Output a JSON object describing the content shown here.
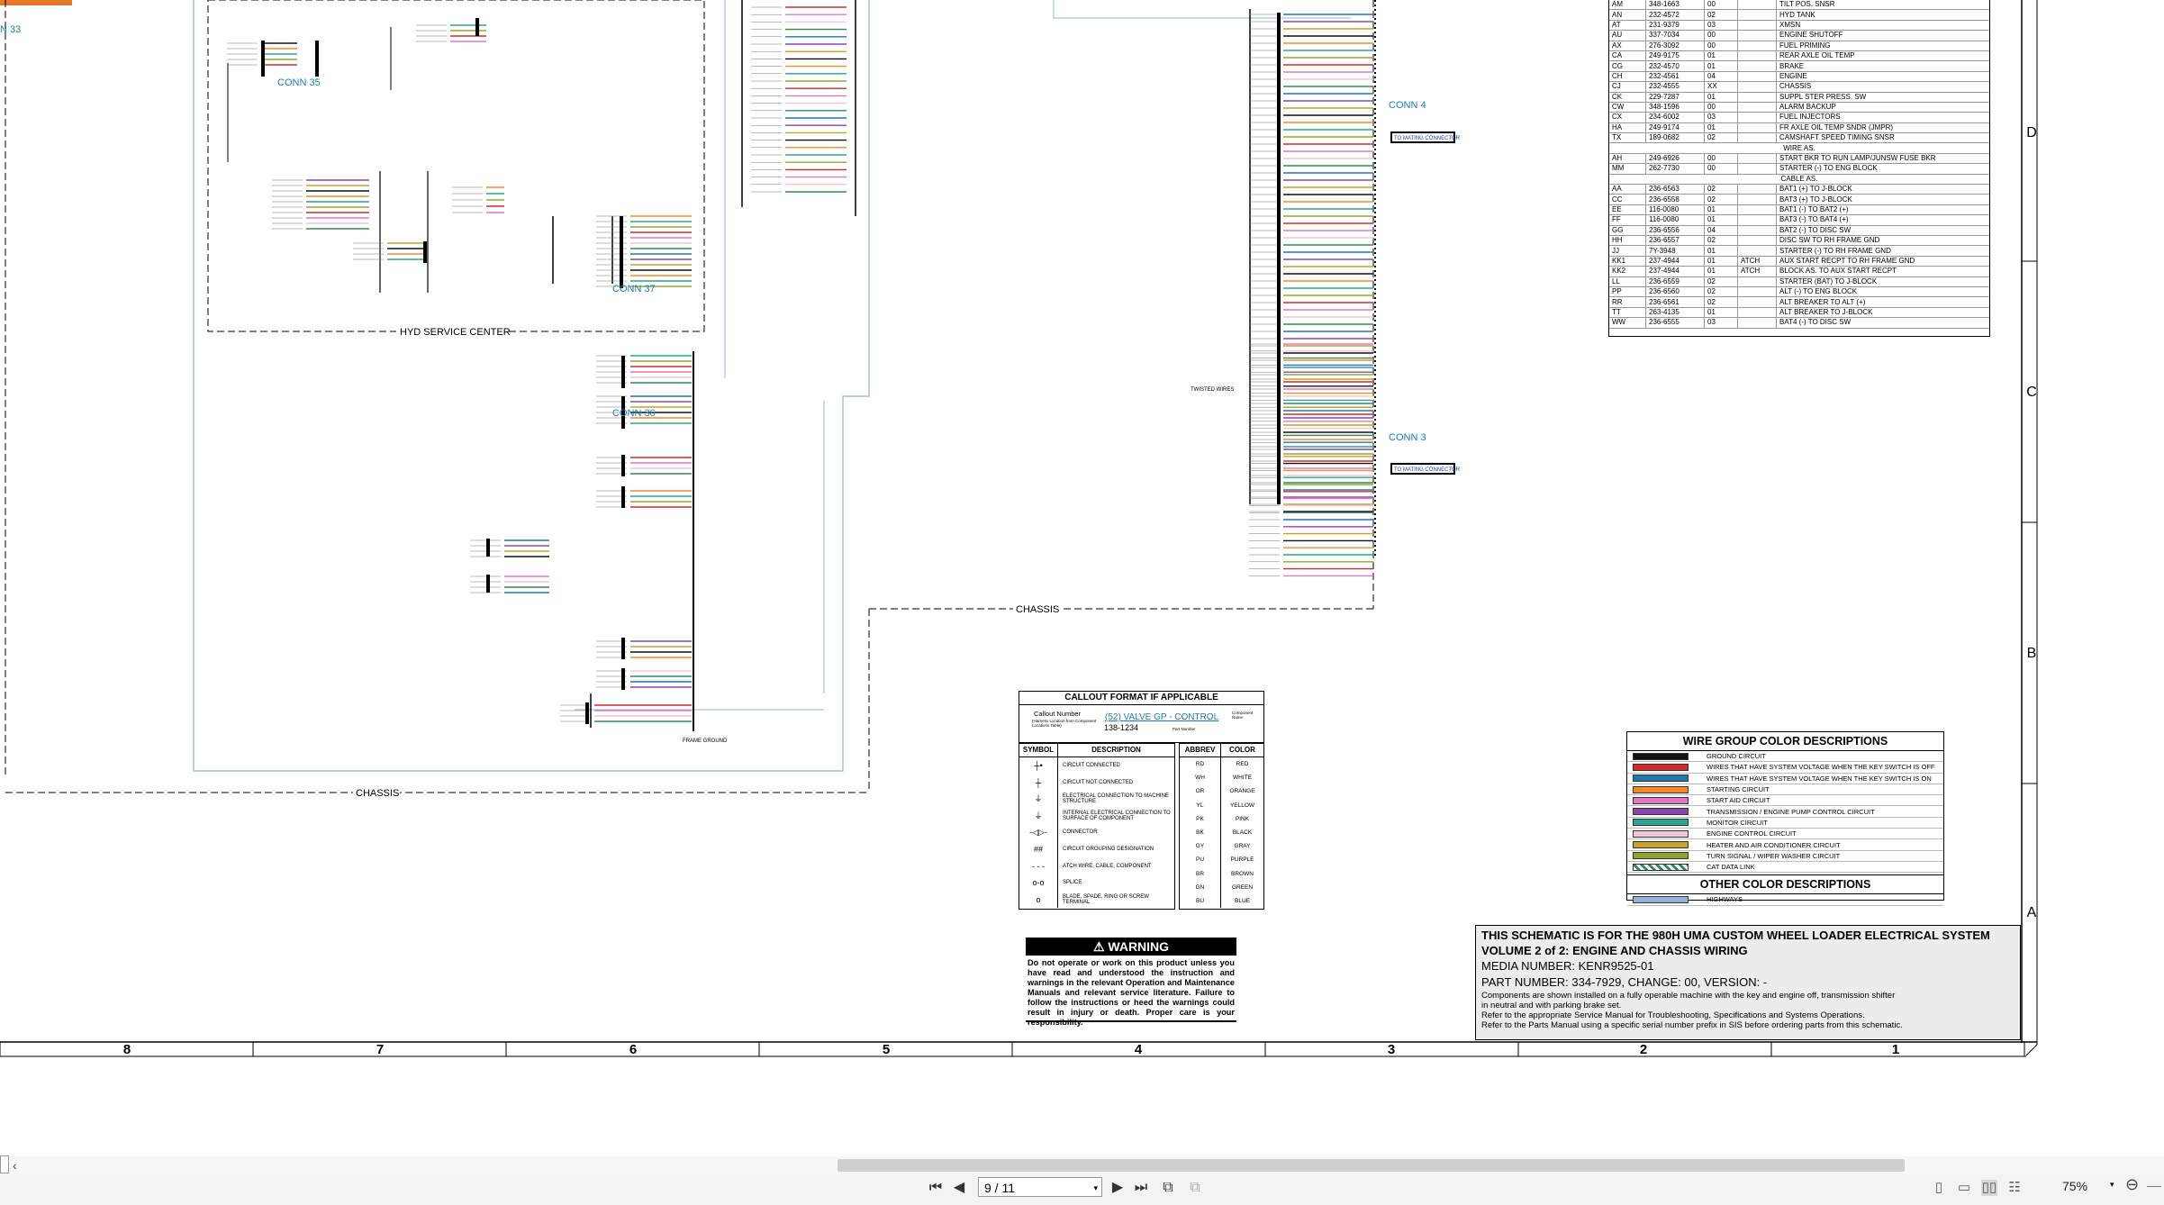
{
  "schematic": {
    "connectors": {
      "conn33": "N 33",
      "conn35": "CONN 35",
      "conn36": "CONN 36",
      "conn37": "CONN 37",
      "conn4": "CONN 4",
      "conn3": "CONN 3"
    },
    "labels": {
      "hyd_service_center": "HYD SERVICE CENTER",
      "chassis_left": "CHASSIS",
      "chassis_right": "CHASSIS",
      "frame_ground": "FRAME GROUND",
      "twisted_wires": "TWISTED WIRES",
      "to_mating_connector_1": "TO MATING CONNECTOR",
      "to_mating_connector_2": "TO MATING CONNECTOR"
    },
    "row_labels": [
      "D",
      "C",
      "B",
      "A"
    ],
    "column_labels": [
      "8",
      "7",
      "6",
      "5",
      "4",
      "3",
      "2",
      "1"
    ]
  },
  "cable_table": {
    "rows": [
      {
        "code": "AM",
        "part": "348-1663",
        "rev": "00",
        "atch": "",
        "desc": "TILT POS. SNSR"
      },
      {
        "code": "AN",
        "part": "232-4572",
        "rev": "02",
        "atch": "",
        "desc": "HYD TANK"
      },
      {
        "code": "AT",
        "part": "231-9379",
        "rev": "03",
        "atch": "",
        "desc": "XMSN"
      },
      {
        "code": "AU",
        "part": "337-7034",
        "rev": "00",
        "atch": "",
        "desc": "ENGINE SHUTOFF"
      },
      {
        "code": "AX",
        "part": "276-3092",
        "rev": "00",
        "atch": "",
        "desc": "FUEL PRIMING"
      },
      {
        "code": "CA",
        "part": "249-9175",
        "rev": "01",
        "atch": "",
        "desc": "REAR AXLE OIL TEMP"
      },
      {
        "code": "CG",
        "part": "232-4570",
        "rev": "01",
        "atch": "",
        "desc": "BRAKE"
      },
      {
        "code": "CH",
        "part": "232-4561",
        "rev": "04",
        "atch": "",
        "desc": "ENGINE"
      },
      {
        "code": "CJ",
        "part": "232-4555",
        "rev": "XX",
        "atch": "",
        "desc": "CHASSIS"
      },
      {
        "code": "CK",
        "part": "229-7287",
        "rev": "01",
        "atch": "",
        "desc": "SUPPL STER PRESS. SW"
      },
      {
        "code": "CW",
        "part": "348-1596",
        "rev": "00",
        "atch": "",
        "desc": "ALARM BACKUP"
      },
      {
        "code": "CX",
        "part": "234-6002",
        "rev": "03",
        "atch": "",
        "desc": "FUEL INJECTORS"
      },
      {
        "code": "HA",
        "part": "249-9174",
        "rev": "01",
        "atch": "",
        "desc": "FR AXLE OIL TEMP SNDR (JMPR)"
      },
      {
        "code": "TX",
        "part": "189-0682",
        "rev": "02",
        "atch": "",
        "desc": "CAMSHAFT SPEED TIMING SNSR"
      }
    ],
    "wire_as_header": "WIRE AS.",
    "wire_as_rows": [
      {
        "code": "AH",
        "part": "249-6926",
        "rev": "00",
        "atch": "",
        "desc": "START BKR TO RUN LAMP/JUNSW FUSE BKR"
      },
      {
        "code": "MM",
        "part": "262-7730",
        "rev": "00",
        "atch": "",
        "desc": "STARTER (-) TO ENG BLOCK"
      }
    ],
    "cable_as_header": "CABLE AS.",
    "cable_as_rows": [
      {
        "code": "AA",
        "part": "236-6563",
        "rev": "02",
        "atch": "",
        "desc": "BAT1 (+) TO J-BLOCK"
      },
      {
        "code": "CC",
        "part": "236-6558",
        "rev": "02",
        "atch": "",
        "desc": "BAT3 (+) TO J-BLOCK"
      },
      {
        "code": "EE",
        "part": "116-0080",
        "rev": "01",
        "atch": "",
        "desc": "BAT1 (-) TO BAT2 (+)"
      },
      {
        "code": "FF",
        "part": "116-0080",
        "rev": "01",
        "atch": "",
        "desc": "BAT3 (-) TO BAT4 (+)"
      },
      {
        "code": "GG",
        "part": "236-6556",
        "rev": "04",
        "atch": "",
        "desc": "BAT2 (-) TO DISC SW"
      },
      {
        "code": "HH",
        "part": "236-6557",
        "rev": "02",
        "atch": "",
        "desc": "DISC SW TO RH FRAME GND"
      },
      {
        "code": "JJ",
        "part": "7Y-3948",
        "rev": "01",
        "atch": "",
        "desc": "STARTER (-) TO RH FRAME GND"
      },
      {
        "code": "KK1",
        "part": "237-4944",
        "rev": "01",
        "atch": "ATCH",
        "desc": "AUX START RECPT TO RH FRAME GND"
      },
      {
        "code": "KK2",
        "part": "237-4944",
        "rev": "01",
        "atch": "ATCH",
        "desc": "BLOCK AS. TO AUX START RECPT"
      },
      {
        "code": "LL",
        "part": "236-6559",
        "rev": "02",
        "atch": "",
        "desc": "STARTER (BAT) TO J-BLOCK"
      },
      {
        "code": "PP",
        "part": "236-6560",
        "rev": "02",
        "atch": "",
        "desc": "ALT (-) TO ENG BLOCK"
      },
      {
        "code": "RR",
        "part": "236-6561",
        "rev": "02",
        "atch": "",
        "desc": "ALT BREAKER TO ALT (+)"
      },
      {
        "code": "TT",
        "part": "263-4135",
        "rev": "01",
        "atch": "",
        "desc": "ALT BREAKER TO J-BLOCK"
      },
      {
        "code": "WW",
        "part": "236-6555",
        "rev": "03",
        "atch": "",
        "desc": "BAT4 (-) TO DISC SW"
      }
    ]
  },
  "callout": {
    "title": "CALLOUT FORMAT IF APPLICABLE",
    "callout_number": "Callout Number",
    "callout_sub": "(Harness Location from Component Locations Table)",
    "example": "(52) VALVE GP - CONTROL",
    "component_name": "Component Name",
    "part_example": "138-1234",
    "part_number": "Part Number"
  },
  "symbols": {
    "header_symbol": "SYMBOL",
    "header_desc": "DESCRIPTION",
    "rows": [
      {
        "glyph": "┼•",
        "desc": "CIRCUIT CONNECTED"
      },
      {
        "glyph": "┼",
        "desc": "CIRCUIT NOT CONNECTED"
      },
      {
        "glyph": "⏚",
        "desc": "ELECTRICAL CONNECTION TO MACHINE STRUCTURE"
      },
      {
        "glyph": "⏚",
        "desc": "INTERNAL ELECTRICAL CONNECTION TO SURFACE OF COMPONENT"
      },
      {
        "glyph": "-◁▷-",
        "desc": "CONNECTOR"
      },
      {
        "glyph": "##",
        "desc": "CIRCUIT GROUPING DESIGNATION"
      },
      {
        "glyph": "- - -",
        "desc": "ATCH WIRE, CABLE, COMPONENT"
      },
      {
        "glyph": "o-o",
        "desc": "SPLICE"
      },
      {
        "glyph": "o",
        "desc": "BLADE, SPADE, RING OR SCREW TERMINAL"
      }
    ]
  },
  "abbrev": {
    "header_abbrev": "ABBREV",
    "header_color": "COLOR",
    "rows": [
      {
        "ab": "RD",
        "col": "RED"
      },
      {
        "ab": "WH",
        "col": "WHITE"
      },
      {
        "ab": "OR",
        "col": "ORANGE"
      },
      {
        "ab": "YL",
        "col": "YELLOW"
      },
      {
        "ab": "PK",
        "col": "PINK"
      },
      {
        "ab": "BK",
        "col": "BLACK"
      },
      {
        "ab": "GY",
        "col": "GRAY"
      },
      {
        "ab": "PU",
        "col": "PURPLE"
      },
      {
        "ab": "BR",
        "col": "BROWN"
      },
      {
        "ab": "GN",
        "col": "GREEN"
      },
      {
        "ab": "BU",
        "col": "BLUE"
      }
    ]
  },
  "wire_group": {
    "title": "WIRE GROUP COLOR DESCRIPTIONS",
    "rows": [
      {
        "color": "#111111",
        "desc": "GROUND CIRCUIT"
      },
      {
        "color": "#d62828",
        "desc": "WIRES THAT HAVE SYSTEM VOLTAGE WHEN THE KEY SWITCH IS OFF"
      },
      {
        "color": "#1f77b4",
        "desc": "WIRES THAT HAVE SYSTEM VOLTAGE WHEN THE KEY SWITCH IS ON"
      },
      {
        "color": "#f28c28",
        "desc": "STARTING CIRCUIT"
      },
      {
        "color": "#e377c2",
        "desc": "START AID CIRCUIT"
      },
      {
        "color": "#8e44ad",
        "desc": "TRANSMISSION / ENGINE PUMP CONTROL CIRCUIT"
      },
      {
        "color": "#2ca58d",
        "desc": "MONITOR CIRCUIT"
      },
      {
        "color": "#f5c6d6",
        "desc": "ENGINE CONTROL CIRCUIT"
      },
      {
        "color": "#c9a227",
        "desc": "HEATER AND AIR CONDITIONER CIRCUIT"
      },
      {
        "color": "#8fa82c",
        "desc": "TURN SIGNAL / WIPER WASHER CIRCUIT"
      },
      {
        "color": "#2e8b57",
        "desc": "CAT DATA LINK"
      }
    ],
    "other_title": "OTHER COLOR DESCRIPTIONS",
    "other_rows": [
      {
        "color": "#8fb3d9",
        "desc": "HIGHWAYS"
      }
    ]
  },
  "warning": {
    "title": "WARNING",
    "body": "Do not operate or work on this product unless you have read and understood the instruction and warnings in the relevant Operation and Maintenance Manuals and relevant service literature. Failure to follow the instructions or heed the warnings could result in injury or death. Proper care is your responsibility."
  },
  "title_block": {
    "line1": "THIS SCHEMATIC IS FOR THE 980H UMA CUSTOM WHEEL LOADER ELECTRICAL SYSTEM",
    "line2": "VOLUME 2 of 2: ENGINE AND CHASSIS WIRING",
    "line3": "MEDIA NUMBER: KENR9525-01",
    "line4": "PART NUMBER: 334-7929, CHANGE: 00, VERSION: -",
    "note1": "Components are shown installed on a fully operable machine with the key and engine off, transmission shifter",
    "note2": "in neutral and with parking brake set.",
    "note3": "Refer to the appropriate Service Manual for Troubleshooting, Specifications and Systems Operations.",
    "note4": "Refer to the Parts Manual using a specific serial number prefix in SIS before ordering parts from this schematic."
  },
  "viewer": {
    "page_value": "9 / 11",
    "zoom": "75%"
  }
}
